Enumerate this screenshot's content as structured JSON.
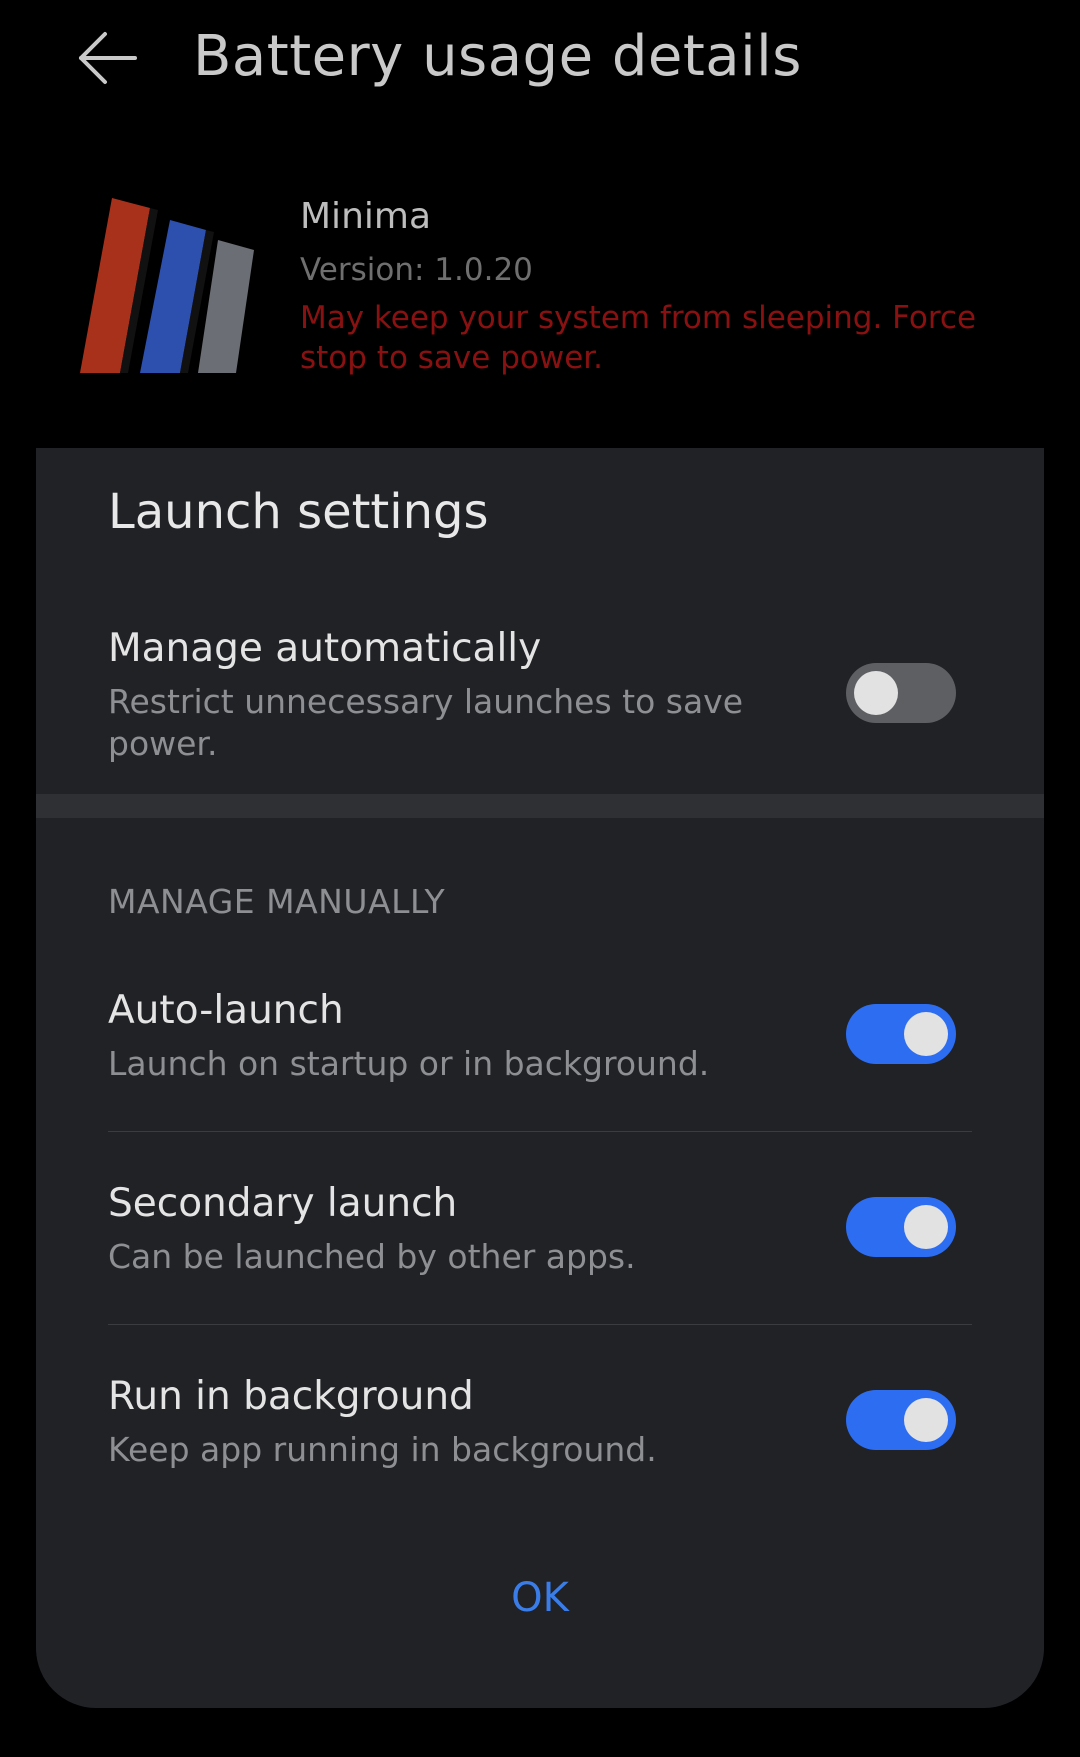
{
  "header": {
    "back_icon": "arrow-left-icon",
    "title": "Battery usage details"
  },
  "app": {
    "logo_icon": "minima-logo-icon",
    "name": "Minima",
    "version": "Version: 1.0.20",
    "warning": "May keep your system from sleeping. Force stop to save power."
  },
  "colors": {
    "background": "#000000",
    "dialog": "#202226",
    "accent": "#2c6df2",
    "warning": "#8a1111",
    "logo_red": "#a8311c",
    "logo_blue": "#2d4fae",
    "logo_gray": "#6b6e75"
  },
  "dialog": {
    "title": "Launch settings",
    "manage_automatically": {
      "title": "Manage automatically",
      "description": "Restrict unnecessary launches to save power.",
      "enabled": false
    },
    "manual_section_header": "MANAGE MANUALLY",
    "manual_items": [
      {
        "title": "Auto-launch",
        "description": "Launch on startup or in background.",
        "enabled": true
      },
      {
        "title": "Secondary launch",
        "description": "Can be launched by other apps.",
        "enabled": true
      },
      {
        "title": "Run in background",
        "description": "Keep app running in background.",
        "enabled": true
      }
    ],
    "ok_label": "OK"
  }
}
